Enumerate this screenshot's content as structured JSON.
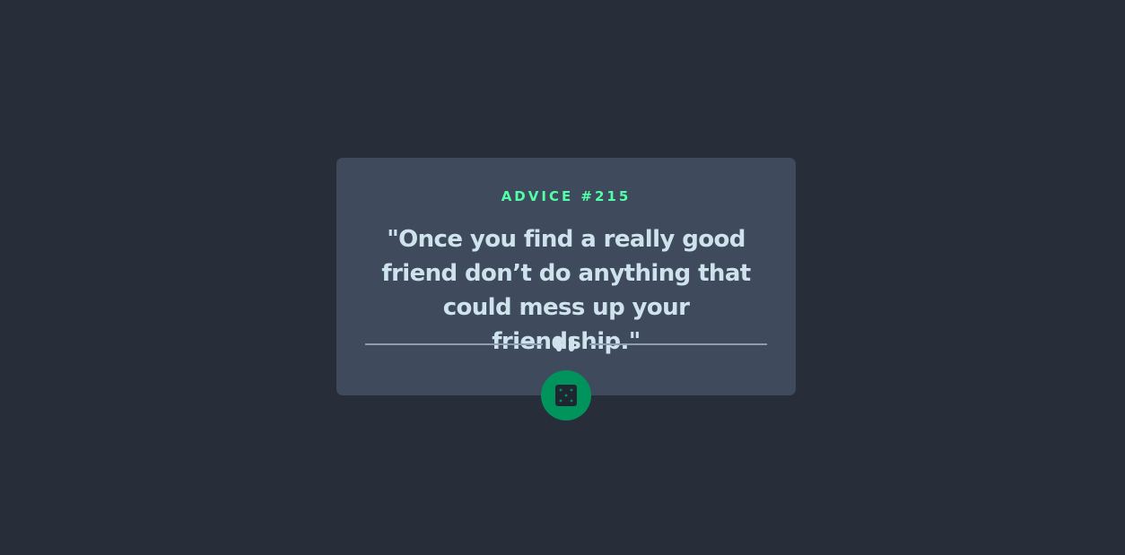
{
  "card": {
    "advice_label": "ADVICE #215",
    "quote": "\"Once you find a really good friend don’t do anything that could mess up your friendship.\""
  },
  "divider": {
    "icon": "pause-icon"
  },
  "action": {
    "icon": "dice-icon"
  },
  "colors": {
    "background": "#282e39",
    "card": "#3f4a5d",
    "accent_text": "#52ffa8",
    "quote_text": "#cfe3ec",
    "button": "#00935c"
  }
}
